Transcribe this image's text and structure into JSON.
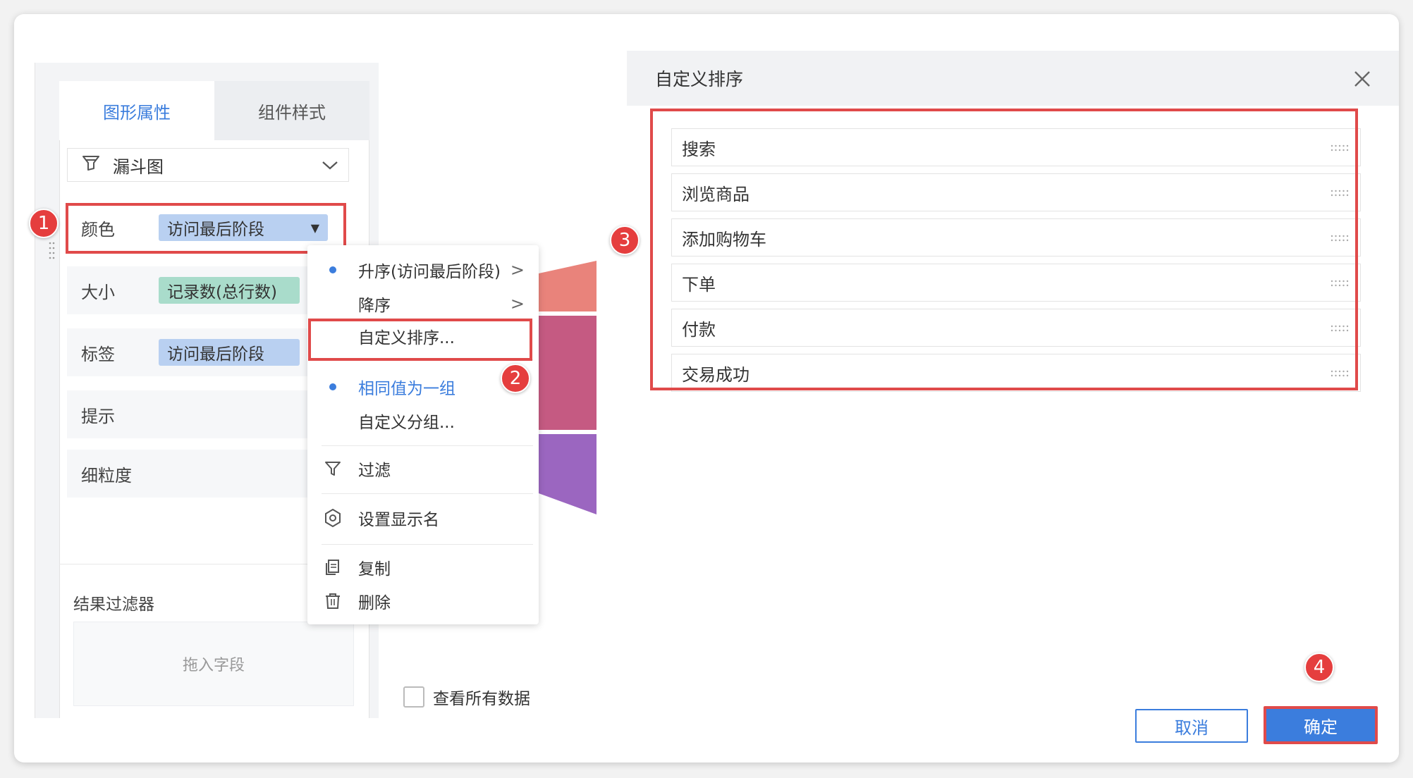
{
  "left_panel": {
    "tabs": [
      {
        "label": "图形属性",
        "active": true
      },
      {
        "label": "组件样式",
        "active": false
      }
    ],
    "chart_type": "漏斗图",
    "rows": [
      {
        "label": "颜色",
        "pill": "访问最后阶段"
      },
      {
        "label": "大小",
        "pill": "记录数(总行数)"
      },
      {
        "label": "标签",
        "pill": "访问最后阶段"
      },
      {
        "label": "提示"
      },
      {
        "label": "细粒度"
      }
    ],
    "filter_title": "结果过滤器",
    "drop_placeholder": "拖入字段"
  },
  "context_menu": {
    "items": [
      {
        "label": "升序(访问最后阶段)",
        "selected": true,
        "submenu": true
      },
      {
        "label": "降序",
        "submenu": true
      },
      {
        "label": "自定义排序..."
      },
      {
        "label": "相同值为一组",
        "selected": true
      },
      {
        "label": "自定义分组..."
      },
      {
        "label": "过滤",
        "icon": "filter-icon"
      },
      {
        "label": "设置显示名",
        "icon": "gear-icon"
      },
      {
        "label": "复制",
        "icon": "copy-icon"
      },
      {
        "label": "删除",
        "icon": "trash-icon"
      }
    ]
  },
  "view_all_data_label": "查看所有数据",
  "dialog": {
    "title": "自定义排序",
    "items": [
      "搜索",
      "浏览商品",
      "添加购物车",
      "下单",
      "付款",
      "交易成功"
    ],
    "cancel_label": "取消",
    "ok_label": "确定"
  },
  "badges": [
    "1",
    "2",
    "3",
    "4"
  ],
  "colors": {
    "accent": "#3b7ddd",
    "highlight": "#e04a4a",
    "badge": "#e53e3e",
    "funnel_1": "#e9837b",
    "funnel_2": "#c55a82",
    "funnel_3": "#9b66c0"
  }
}
